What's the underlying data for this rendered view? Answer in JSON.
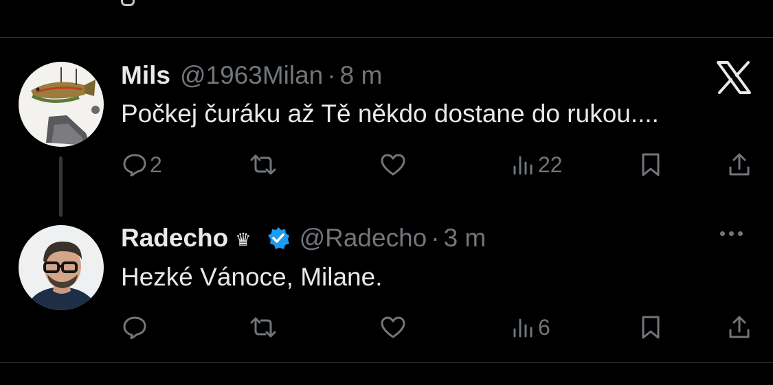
{
  "tweets": [
    {
      "name": "Mils",
      "handle": "@1963Milan",
      "separator": "·",
      "time": "8 m",
      "text": "Počkej čuráku až Tě někdo dostane do rukou....",
      "avatar_icon": "fish-boot-avatar",
      "actions": {
        "replies": "2",
        "retweets": "",
        "likes": "",
        "views": "22"
      }
    },
    {
      "name": "Radecho",
      "badge_icon": "crown-icon",
      "verified_icon": "verified-badge-icon",
      "handle": "@Radecho",
      "separator": "·",
      "time": "3 m",
      "text": "Hezké Vánoce, Milane.",
      "avatar_icon": "man-with-glasses-avatar",
      "actions": {
        "replies": "",
        "retweets": "",
        "likes": "",
        "views": "6"
      }
    }
  ],
  "header_icon": "x-logo-icon",
  "colors": {
    "background": "#000000",
    "text_primary": "#e7e9ea",
    "text_secondary": "#71767b",
    "divider": "#2f3336",
    "verified": "#1d9bf0"
  }
}
